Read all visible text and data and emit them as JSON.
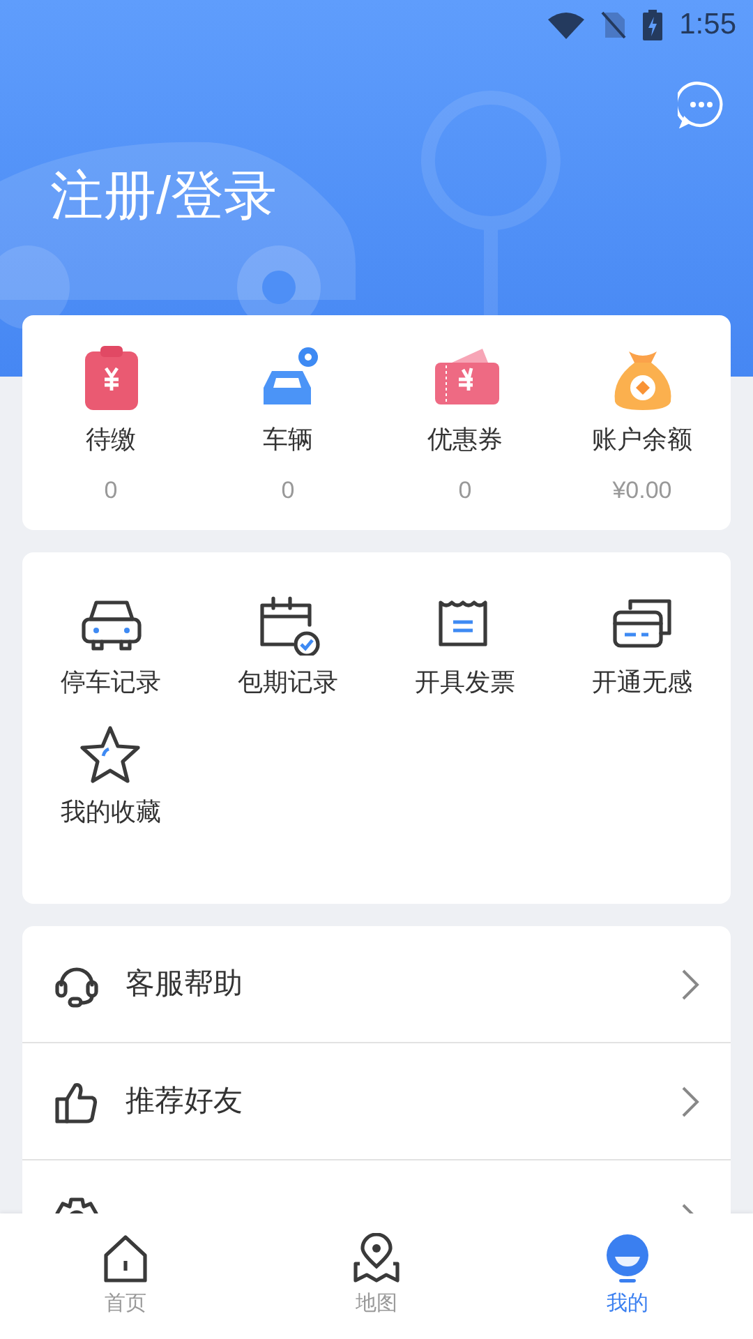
{
  "status_bar": {
    "time": "1:55"
  },
  "header": {
    "title": "注册/登录"
  },
  "assets": [
    {
      "kind": "bill",
      "label": "待缴",
      "value": "0"
    },
    {
      "kind": "car",
      "label": "车辆",
      "value": "0"
    },
    {
      "kind": "coupon",
      "label": "优惠券",
      "value": "0"
    },
    {
      "kind": "moneybag",
      "label": "账户余额",
      "value": "¥0.00"
    }
  ],
  "services": [
    {
      "kind": "parking",
      "label": "停车记录"
    },
    {
      "kind": "calendar",
      "label": "包期记录"
    },
    {
      "kind": "invoice",
      "label": "开具发票"
    },
    {
      "kind": "card",
      "label": "开通无感"
    },
    {
      "kind": "star",
      "label": "我的收藏"
    }
  ],
  "menu": [
    {
      "kind": "headset",
      "label": "客服帮助"
    },
    {
      "kind": "thumb",
      "label": "推荐好友"
    },
    {
      "kind": "gear"
    }
  ],
  "tabs": [
    {
      "kind": "home",
      "label": "首页",
      "selected": false
    },
    {
      "kind": "map",
      "label": "地图",
      "selected": false
    },
    {
      "kind": "mine",
      "label": "我的",
      "selected": true
    }
  ]
}
